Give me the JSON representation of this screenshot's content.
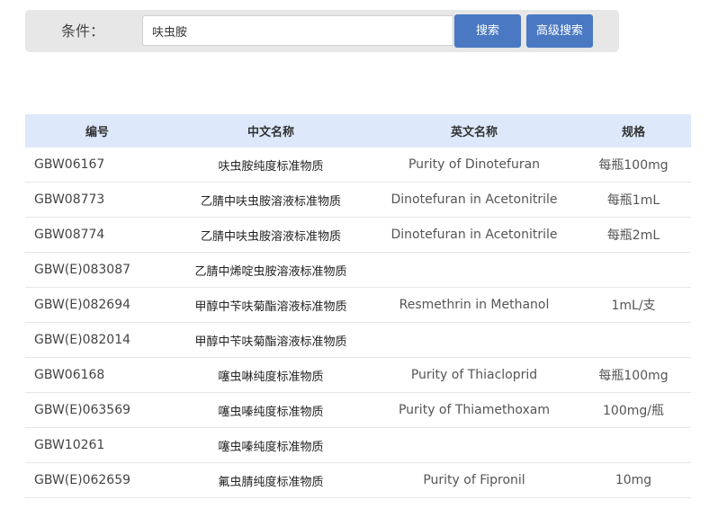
{
  "search": {
    "condition_label": "条件：",
    "query": "呋虫胺",
    "search_button": "搜索",
    "advanced_button": "高级搜索"
  },
  "table": {
    "headers": [
      "编号",
      "中文名称",
      "英文名称",
      "规格"
    ],
    "rows": [
      {
        "id": "GBW06167",
        "cn": "呋虫胺纯度标准物质",
        "en": "Purity of Dinotefuran",
        "spec": "每瓶100mg"
      },
      {
        "id": "GBW08773",
        "cn": "乙腈中呋虫胺溶液标准物质",
        "en": "Dinotefuran in Acetonitrile",
        "spec": "每瓶1mL"
      },
      {
        "id": "GBW08774",
        "cn": "乙腈中呋虫胺溶液标准物质",
        "en": "Dinotefuran in Acetonitrile",
        "spec": "每瓶2mL"
      },
      {
        "id": "GBW(E)083087",
        "cn": "乙腈中烯啶虫胺溶液标准物质",
        "en": "",
        "spec": ""
      },
      {
        "id": "GBW(E)082694",
        "cn": "甲醇中苄呋菊酯溶液标准物质",
        "en": "Resmethrin in Methanol",
        "spec": "1mL/支"
      },
      {
        "id": "GBW(E)082014",
        "cn": "甲醇中苄呋菊酯溶液标准物质",
        "en": "",
        "spec": ""
      },
      {
        "id": "GBW06168",
        "cn": "噻虫啉纯度标准物质",
        "en": "Purity of Thiacloprid",
        "spec": "每瓶100mg"
      },
      {
        "id": "GBW(E)063569",
        "cn": "噻虫嗪纯度标准物质",
        "en": "Purity of Thiamethoxam",
        "spec": "100mg/瓶"
      },
      {
        "id": "GBW10261",
        "cn": "噻虫嗪纯度标准物质",
        "en": "",
        "spec": ""
      },
      {
        "id": "GBW(E)062659",
        "cn": "氟虫腈纯度标准物质",
        "en": "Purity of Fipronil",
        "spec": "10mg"
      }
    ]
  }
}
